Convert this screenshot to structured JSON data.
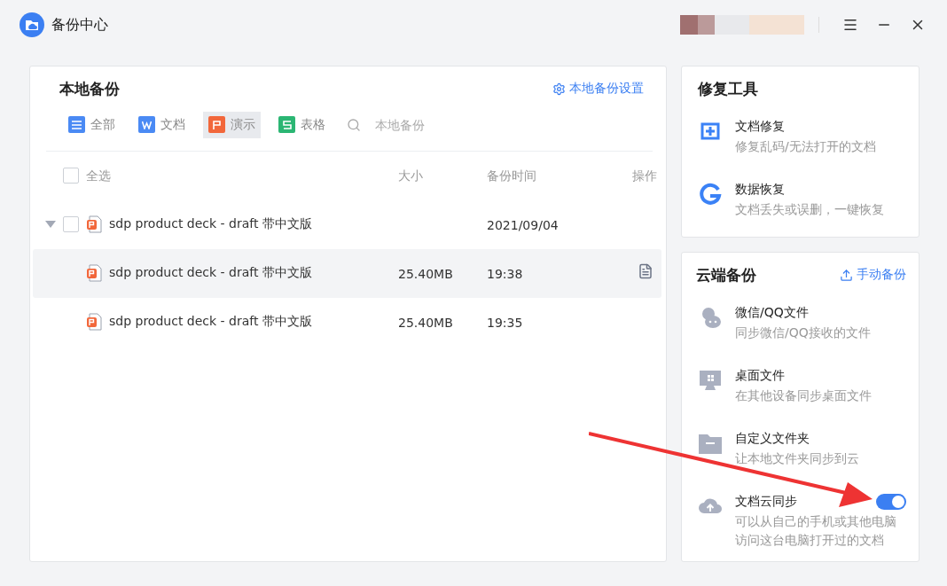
{
  "window": {
    "title": "备份中心"
  },
  "local_backup": {
    "title": "本地备份",
    "settings_link": "本地备份设置",
    "filters": [
      {
        "label": "全部",
        "kind": "all",
        "selected": false
      },
      {
        "label": "文档",
        "kind": "doc",
        "selected": false
      },
      {
        "label": "演示",
        "kind": "ppt",
        "selected": true
      },
      {
        "label": "表格",
        "kind": "sheet",
        "selected": false
      }
    ],
    "search": {
      "placeholder": "本地备份"
    },
    "select_all": {
      "label": "全选",
      "checked": false
    },
    "columns": [
      "大小",
      "备份时间",
      "操作"
    ],
    "rows": [
      {
        "name": "sdp product deck - draft 带中文版",
        "time": "2021/09/04",
        "expanded": true,
        "checked": false,
        "children": [
          {
            "name": "sdp product deck - draft 带中文版",
            "size": "25.40MB",
            "time": "19:38",
            "selected": true
          },
          {
            "name": "sdp product deck - draft 带中文版",
            "size": "25.40MB",
            "time": "19:35",
            "selected": false
          }
        ]
      }
    ]
  },
  "repair_tools": {
    "title": "修复工具",
    "items": [
      {
        "title": "文档修复",
        "desc": "修复乱码/无法打开的文档"
      },
      {
        "title": "数据恢复",
        "desc": "文档丢失或误删，一键恢复"
      }
    ]
  },
  "cloud_backup": {
    "title": "云端备份",
    "action": "手动备份",
    "items": [
      {
        "title": "微信/QQ文件",
        "desc": "同步微信/QQ接收的文件",
        "kind": "link"
      },
      {
        "title": "桌面文件",
        "desc": "在其他设备同步桌面文件",
        "kind": "link"
      },
      {
        "title": "自定义文件夹",
        "desc": "让本地文件夹同步到云",
        "kind": "link"
      },
      {
        "title": "文档云同步",
        "desc": "可以从自己的手机或其他电脑访问这台电脑打开过的文档",
        "kind": "toggle",
        "on": true
      }
    ]
  }
}
